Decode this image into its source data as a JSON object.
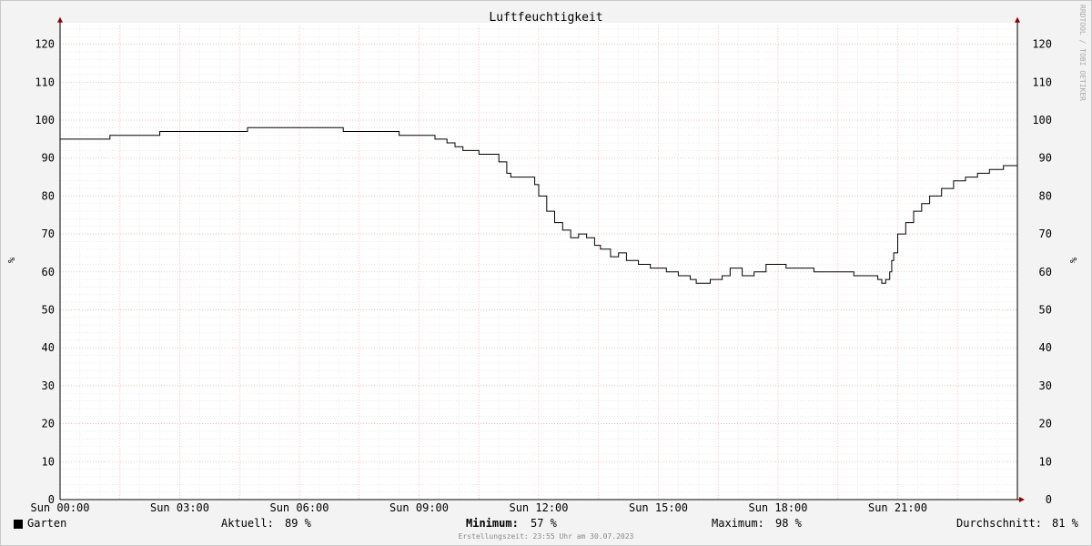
{
  "chart_data": {
    "type": "line",
    "title": "Luftfeuchtigkeit",
    "ylabel": "%",
    "xlim": [
      "Sun 00:00",
      "Sun 24:00"
    ],
    "ylim": [
      0,
      125
    ],
    "yticks": [
      0,
      10,
      20,
      30,
      40,
      50,
      60,
      70,
      80,
      90,
      100,
      110,
      120
    ],
    "xticks": [
      "Sun 00:00",
      "Sun 03:00",
      "Sun 06:00",
      "Sun 09:00",
      "Sun 12:00",
      "Sun 15:00",
      "Sun 18:00",
      "Sun 21:00"
    ],
    "grid": true,
    "legend_position": "bottom",
    "watermark": "RRDTOOL / TOBI OETIKER",
    "series": [
      {
        "name": "Garten",
        "color": "#000000",
        "x_hours": [
          0,
          1.25,
          2.5,
          4.7,
          7.1,
          8.5,
          9.4,
          9.7,
          9.9,
          10.1,
          10.5,
          11.0,
          11.2,
          11.3,
          11.9,
          12.0,
          12.2,
          12.4,
          12.6,
          12.8,
          13.0,
          13.2,
          13.4,
          13.55,
          13.8,
          14.0,
          14.2,
          14.5,
          14.8,
          15.2,
          15.5,
          15.8,
          15.95,
          16.3,
          16.6,
          16.8,
          17.1,
          17.4,
          17.7,
          18.2,
          18.9,
          19.9,
          20.5,
          20.6,
          20.7,
          20.8,
          20.85,
          20.9,
          21.0,
          21.2,
          21.4,
          21.6,
          21.8,
          22.1,
          22.4,
          22.7,
          23.0,
          23.3,
          23.65,
          24.0
        ],
        "values": [
          95,
          96,
          97,
          98,
          97,
          96,
          95,
          94,
          93,
          92,
          91,
          89,
          86,
          85,
          83,
          80,
          76,
          73,
          71,
          69,
          70,
          69,
          67,
          66,
          64,
          65,
          63,
          62,
          61,
          60,
          59,
          58,
          57,
          58,
          59,
          61,
          59,
          60,
          62,
          61,
          60,
          59,
          58,
          57,
          58,
          60,
          63,
          65,
          70,
          73,
          76,
          78,
          80,
          82,
          84,
          85,
          86,
          87,
          88,
          89
        ]
      }
    ]
  },
  "legend": {
    "series_label": "Garten",
    "current_label": "Aktuell:",
    "current_value": "89 %",
    "min_label": "Minimum:",
    "min_value": "57 %",
    "max_label": "Maximum:",
    "max_value": "98 %",
    "avg_label": "Durchschnitt:",
    "avg_value": "81 %"
  },
  "footer": "Erstellungszeit: 23:55 Uhr am 30.07.2023"
}
